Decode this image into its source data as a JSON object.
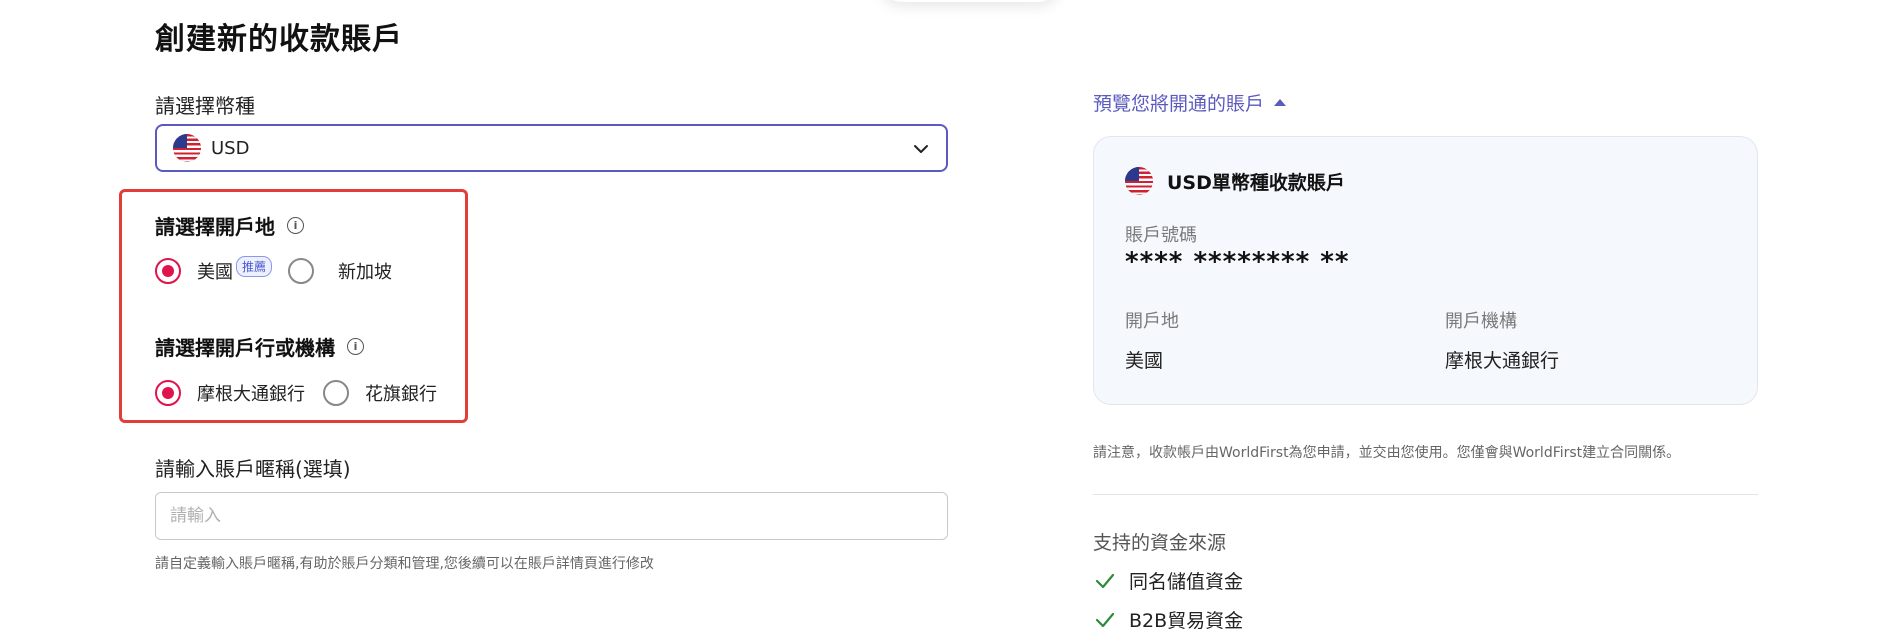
{
  "page": {
    "title": "創建新的收款賬戶"
  },
  "currency": {
    "label": "請選擇幣種",
    "selected": "USD"
  },
  "location": {
    "title": "請選擇開戶地",
    "options": [
      {
        "label": "美國",
        "badge": "推薦",
        "selected": true
      },
      {
        "label": "新加坡",
        "selected": false
      }
    ]
  },
  "bank": {
    "title": "請選擇開戶行或機構",
    "options": [
      {
        "label": "摩根大通銀行",
        "selected": true
      },
      {
        "label": "花旗銀行",
        "selected": false
      }
    ]
  },
  "nickname": {
    "label": "請輸入賬戶暱稱(選填)",
    "placeholder": "請輸入",
    "value": "",
    "hint": "請自定義輸入賬戶暱稱,有助於賬戶分類和管理,您後續可以在賬戶詳情頁進行修改"
  },
  "preview": {
    "link": "預覽您將開通的賬戶",
    "card_title": "USD單幣種收款賬戶",
    "account_number_label": "賬戶號碼",
    "account_number": "**** ******** **",
    "location_label": "開戶地",
    "location_value": "美國",
    "institution_label": "開戶機構",
    "institution_value": "摩根大通銀行"
  },
  "notice": "請注意，收款帳戶由WorldFirst為您申請，並交由您使用。您僅會與WorldFirst建立合同關係。",
  "funding": {
    "title": "支持的資金來源",
    "items": [
      "同名儲值資金",
      "B2B貿易資金"
    ]
  },
  "colors": {
    "accent": "#5b5bbf",
    "radio_selected": "#e0144c",
    "highlight_border": "#e33d3a",
    "check": "#2e8b3a"
  }
}
